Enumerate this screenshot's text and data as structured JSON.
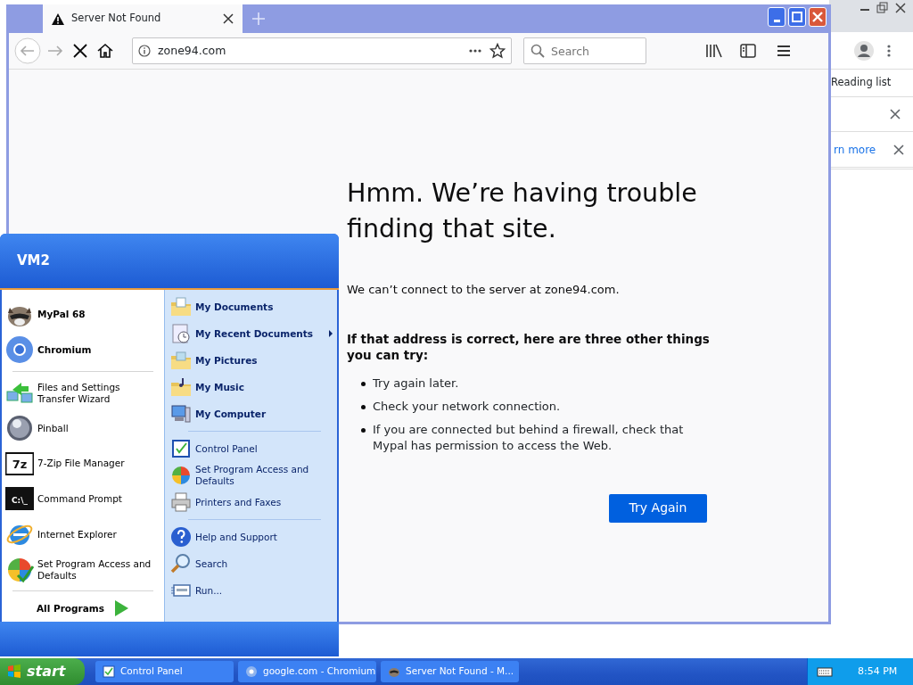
{
  "background_window": {
    "reading_list": "Reading list",
    "link_fragment": "rn more"
  },
  "browser": {
    "tab_title": "Server Not Found",
    "address": "zone94.com",
    "search_placeholder": "Search"
  },
  "error_page": {
    "title": "Hmm. We’re having trouble finding that site.",
    "message": "We can’t connect to the server at zone94.com.",
    "subtitle": "If that address is correct, here are three other things you can try:",
    "tips": [
      "Try again later.",
      "Check your network connection.",
      "If you are connected but behind a firewall, check that Mypal has permission to access the Web."
    ],
    "button": "Try Again"
  },
  "start_menu": {
    "user": "VM2",
    "pinned": [
      {
        "label": "MyPal 68"
      },
      {
        "label": "Chromium"
      }
    ],
    "recent": [
      {
        "label": "Files and Settings Transfer Wizard"
      },
      {
        "label": "Pinball"
      },
      {
        "label": "7-Zip File Manager",
        "icon_text": "7z"
      },
      {
        "label": "Command Prompt",
        "icon_text": "C:\\_"
      },
      {
        "label": "Internet Explorer"
      },
      {
        "label": "Set Program Access and Defaults"
      }
    ],
    "all_programs": "All Programs",
    "places": [
      {
        "label": "My Documents",
        "submenu": false
      },
      {
        "label": "My Recent Documents",
        "submenu": true
      },
      {
        "label": "My Pictures",
        "submenu": false
      },
      {
        "label": "My Music",
        "submenu": false
      },
      {
        "label": "My Computer",
        "submenu": false
      }
    ],
    "settings": [
      {
        "label": "Control Panel"
      },
      {
        "label": "Set Program Access and Defaults"
      },
      {
        "label": "Printers and Faxes"
      }
    ],
    "tools": [
      {
        "label": "Help and Support"
      },
      {
        "label": "Search"
      },
      {
        "label": "Run..."
      }
    ]
  },
  "taskbar": {
    "start": "start",
    "tasks": [
      {
        "label": "Control Panel"
      },
      {
        "label": "google.com - Chromium"
      },
      {
        "label": "Server Not Found - M..."
      }
    ],
    "clock": "8:54 PM"
  }
}
